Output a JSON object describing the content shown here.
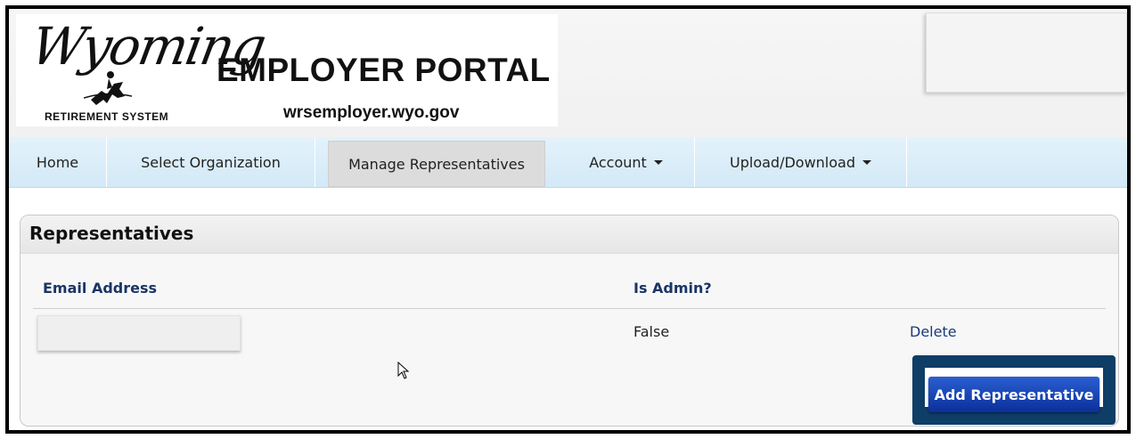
{
  "header": {
    "logo_script": "Wyoming",
    "logo_subtitle": "RETIREMENT SYSTEM",
    "portal_title": "EMPLOYER PORTAL",
    "portal_url": "wrsemployer.wyo.gov"
  },
  "nav": {
    "items": [
      {
        "label": "Home",
        "active": false
      },
      {
        "label": "Select Organization",
        "active": false
      },
      {
        "label": "Manage Representatives",
        "active": true
      },
      {
        "label": "Account",
        "active": false,
        "dropdown": true
      },
      {
        "label": "Upload/Download",
        "active": false,
        "dropdown": true
      }
    ]
  },
  "panel": {
    "title": "Representatives",
    "columns": [
      "Email Address",
      "Is Admin?"
    ],
    "rows": [
      {
        "email": "",
        "is_admin": "False",
        "action": "Delete"
      }
    ],
    "add_button": "Add Representative"
  },
  "colors": {
    "nav_bg": "#d3e9f7",
    "header_text": "#1a3566",
    "button": "#0b2f9a",
    "highlight": "#0e3d66"
  }
}
